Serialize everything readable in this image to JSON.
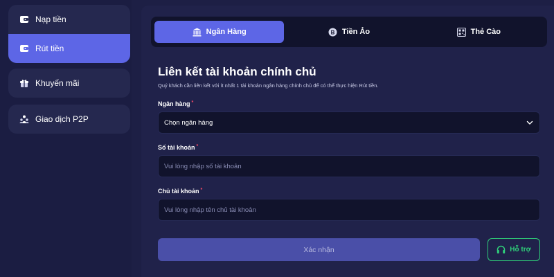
{
  "sidebar": {
    "items": [
      {
        "label": "Nạp tiền",
        "icon": "wallet-icon"
      },
      {
        "label": "Rút tiền",
        "icon": "wallet-icon",
        "active": true
      },
      {
        "label": "Khuyến mãi",
        "icon": "gift-icon"
      },
      {
        "label": "Giao dịch P2P",
        "icon": "users-icon"
      }
    ]
  },
  "tabs": [
    {
      "label": "Ngân Hàng",
      "icon": "bank-icon",
      "active": true
    },
    {
      "label": "Tiền Ảo",
      "icon": "bitcoin-icon"
    },
    {
      "label": "Thẻ Cào",
      "icon": "qr-card-icon"
    }
  ],
  "form": {
    "title": "Liên kết tài khoản chính chủ",
    "description": "Quý khách cần liên kết với ít nhất 1 tài khoản ngân hàng chính chủ để có thể thực hiện Rút tiền.",
    "bank": {
      "label": "Ngân hàng",
      "required_mark": "*",
      "value": "Chọn ngân hàng"
    },
    "account_number": {
      "label": "Số tài khoản",
      "required_mark": "*",
      "placeholder": "Vui lòng nhập số tài khoản"
    },
    "account_holder": {
      "label": "Chủ tài khoản",
      "required_mark": "*",
      "placeholder": "Vui lòng nhập tên chủ tài khoản"
    },
    "confirm_label": "Xác nhận",
    "support_label": "Hỗ trợ"
  },
  "colors": {
    "accent": "#5d66e6",
    "background": "#1d1f45",
    "support_green": "#2fd07a",
    "required_red": "#ff4d6a"
  }
}
